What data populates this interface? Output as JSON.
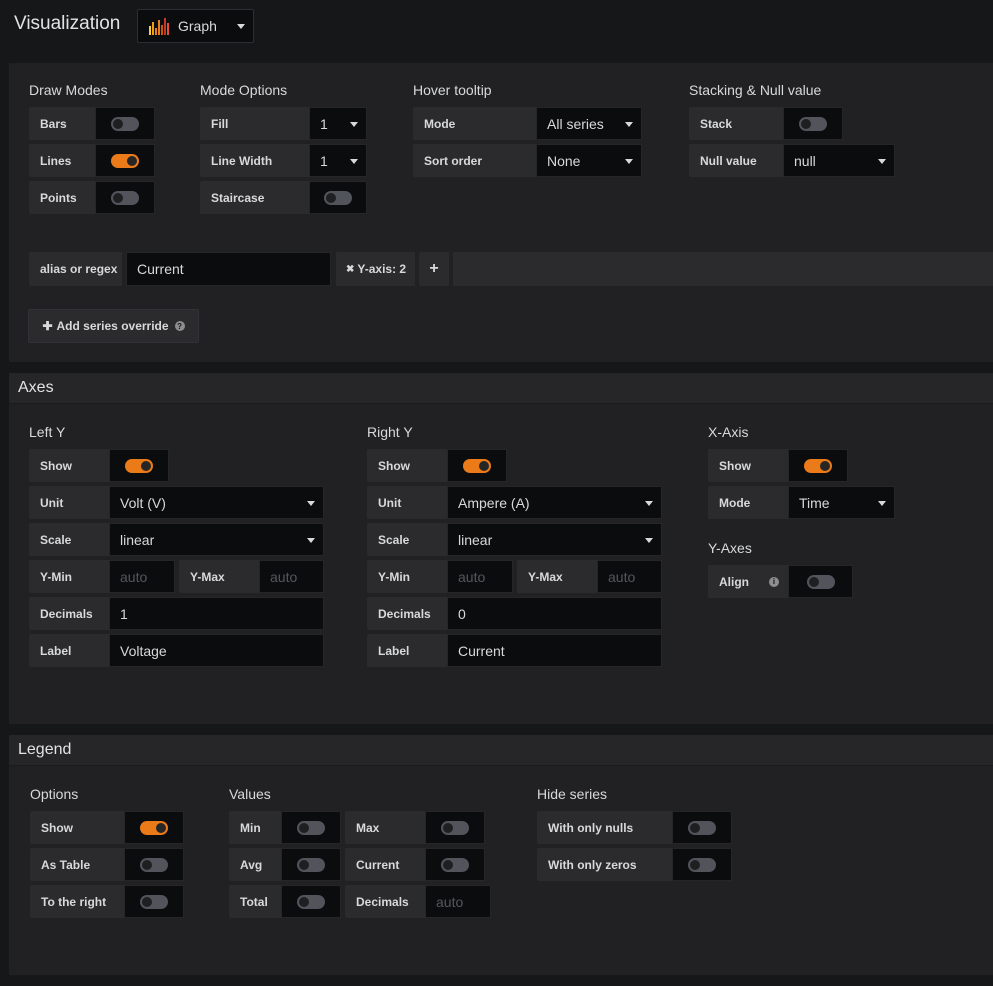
{
  "header": {
    "title": "Visualization",
    "viz": {
      "label": "Graph",
      "icon": "graph-icon"
    }
  },
  "display": {
    "draw_modes": {
      "title": "Draw Modes",
      "bars": "Bars",
      "lines": "Lines",
      "points": "Points",
      "bars_on": false,
      "lines_on": true,
      "points_on": false
    },
    "mode_options": {
      "title": "Mode Options",
      "fill": "Fill",
      "fill_value": "1",
      "line_width": "Line Width",
      "line_width_value": "1",
      "staircase": "Staircase",
      "staircase_on": false
    },
    "hover": {
      "title": "Hover tooltip",
      "mode": "Mode",
      "mode_value": "All series",
      "sort": "Sort order",
      "sort_value": "None"
    },
    "stacking": {
      "title": "Stacking & Null value",
      "stack": "Stack",
      "stack_on": false,
      "null_value": "Null value",
      "null_value_value": "null"
    },
    "override": {
      "alias_label": "alias or regex",
      "alias_value": "Current",
      "tag_remove": "✖",
      "tag": "Y-axis: 2",
      "add_icon": "+",
      "add_series_icon": "✚",
      "add_series": "Add series override",
      "help_icon": "?"
    }
  },
  "axes": {
    "title": "Axes",
    "left_y": {
      "title": "Left Y",
      "show": "Show",
      "show_on": true,
      "unit": "Unit",
      "unit_value": "Volt (V)",
      "scale": "Scale",
      "scale_value": "linear",
      "ymin": "Y-Min",
      "ymin_placeholder": "auto",
      "ymax": "Y-Max",
      "ymax_placeholder": "auto",
      "decimals": "Decimals",
      "decimals_value": "1",
      "label": "Label",
      "label_value": "Voltage"
    },
    "right_y": {
      "title": "Right Y",
      "show": "Show",
      "show_on": true,
      "unit": "Unit",
      "unit_value": "Ampere (A)",
      "scale": "Scale",
      "scale_value": "linear",
      "ymin": "Y-Min",
      "ymin_placeholder": "auto",
      "ymax": "Y-Max",
      "ymax_placeholder": "auto",
      "decimals": "Decimals",
      "decimals_value": "0",
      "label": "Label",
      "label_value": "Current"
    },
    "x_axis": {
      "title": "X-Axis",
      "show": "Show",
      "show_on": true,
      "mode": "Mode",
      "mode_value": "Time"
    },
    "y_axes": {
      "title": "Y-Axes",
      "align": "Align",
      "align_on": false,
      "info_icon": "i"
    }
  },
  "legend": {
    "title": "Legend",
    "options": {
      "title": "Options",
      "show": "Show",
      "show_on": true,
      "as_table": "As Table",
      "as_table_on": false,
      "right": "To the right",
      "right_on": false
    },
    "values": {
      "title": "Values",
      "min": "Min",
      "max": "Max",
      "avg": "Avg",
      "current": "Current",
      "total": "Total",
      "decimals": "Decimals",
      "decimals_placeholder": "auto"
    },
    "hide": {
      "title": "Hide series",
      "nulls": "With only nulls",
      "zeros": "With only zeros"
    }
  },
  "colors": {
    "accent": "#eb7b18",
    "panel": "#212124",
    "background": "#161719"
  }
}
